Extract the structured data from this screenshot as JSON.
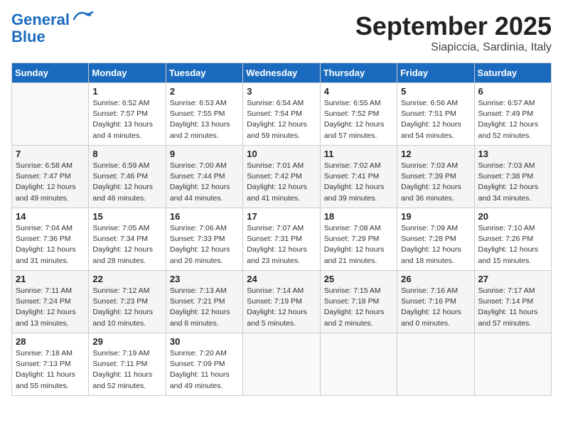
{
  "header": {
    "logo_line1": "General",
    "logo_line2": "Blue",
    "month": "September 2025",
    "location": "Siapiccia, Sardinia, Italy"
  },
  "weekdays": [
    "Sunday",
    "Monday",
    "Tuesday",
    "Wednesday",
    "Thursday",
    "Friday",
    "Saturday"
  ],
  "weeks": [
    [
      {
        "day": "",
        "info": ""
      },
      {
        "day": "1",
        "info": "Sunrise: 6:52 AM\nSunset: 7:57 PM\nDaylight: 13 hours\nand 4 minutes."
      },
      {
        "day": "2",
        "info": "Sunrise: 6:53 AM\nSunset: 7:55 PM\nDaylight: 13 hours\nand 2 minutes."
      },
      {
        "day": "3",
        "info": "Sunrise: 6:54 AM\nSunset: 7:54 PM\nDaylight: 12 hours\nand 59 minutes."
      },
      {
        "day": "4",
        "info": "Sunrise: 6:55 AM\nSunset: 7:52 PM\nDaylight: 12 hours\nand 57 minutes."
      },
      {
        "day": "5",
        "info": "Sunrise: 6:56 AM\nSunset: 7:51 PM\nDaylight: 12 hours\nand 54 minutes."
      },
      {
        "day": "6",
        "info": "Sunrise: 6:57 AM\nSunset: 7:49 PM\nDaylight: 12 hours\nand 52 minutes."
      }
    ],
    [
      {
        "day": "7",
        "info": "Sunrise: 6:58 AM\nSunset: 7:47 PM\nDaylight: 12 hours\nand 49 minutes."
      },
      {
        "day": "8",
        "info": "Sunrise: 6:59 AM\nSunset: 7:46 PM\nDaylight: 12 hours\nand 46 minutes."
      },
      {
        "day": "9",
        "info": "Sunrise: 7:00 AM\nSunset: 7:44 PM\nDaylight: 12 hours\nand 44 minutes."
      },
      {
        "day": "10",
        "info": "Sunrise: 7:01 AM\nSunset: 7:42 PM\nDaylight: 12 hours\nand 41 minutes."
      },
      {
        "day": "11",
        "info": "Sunrise: 7:02 AM\nSunset: 7:41 PM\nDaylight: 12 hours\nand 39 minutes."
      },
      {
        "day": "12",
        "info": "Sunrise: 7:03 AM\nSunset: 7:39 PM\nDaylight: 12 hours\nand 36 minutes."
      },
      {
        "day": "13",
        "info": "Sunrise: 7:03 AM\nSunset: 7:38 PM\nDaylight: 12 hours\nand 34 minutes."
      }
    ],
    [
      {
        "day": "14",
        "info": "Sunrise: 7:04 AM\nSunset: 7:36 PM\nDaylight: 12 hours\nand 31 minutes."
      },
      {
        "day": "15",
        "info": "Sunrise: 7:05 AM\nSunset: 7:34 PM\nDaylight: 12 hours\nand 28 minutes."
      },
      {
        "day": "16",
        "info": "Sunrise: 7:06 AM\nSunset: 7:33 PM\nDaylight: 12 hours\nand 26 minutes."
      },
      {
        "day": "17",
        "info": "Sunrise: 7:07 AM\nSunset: 7:31 PM\nDaylight: 12 hours\nand 23 minutes."
      },
      {
        "day": "18",
        "info": "Sunrise: 7:08 AM\nSunset: 7:29 PM\nDaylight: 12 hours\nand 21 minutes."
      },
      {
        "day": "19",
        "info": "Sunrise: 7:09 AM\nSunset: 7:28 PM\nDaylight: 12 hours\nand 18 minutes."
      },
      {
        "day": "20",
        "info": "Sunrise: 7:10 AM\nSunset: 7:26 PM\nDaylight: 12 hours\nand 15 minutes."
      }
    ],
    [
      {
        "day": "21",
        "info": "Sunrise: 7:11 AM\nSunset: 7:24 PM\nDaylight: 12 hours\nand 13 minutes."
      },
      {
        "day": "22",
        "info": "Sunrise: 7:12 AM\nSunset: 7:23 PM\nDaylight: 12 hours\nand 10 minutes."
      },
      {
        "day": "23",
        "info": "Sunrise: 7:13 AM\nSunset: 7:21 PM\nDaylight: 12 hours\nand 8 minutes."
      },
      {
        "day": "24",
        "info": "Sunrise: 7:14 AM\nSunset: 7:19 PM\nDaylight: 12 hours\nand 5 minutes."
      },
      {
        "day": "25",
        "info": "Sunrise: 7:15 AM\nSunset: 7:18 PM\nDaylight: 12 hours\nand 2 minutes."
      },
      {
        "day": "26",
        "info": "Sunrise: 7:16 AM\nSunset: 7:16 PM\nDaylight: 12 hours\nand 0 minutes."
      },
      {
        "day": "27",
        "info": "Sunrise: 7:17 AM\nSunset: 7:14 PM\nDaylight: 11 hours\nand 57 minutes."
      }
    ],
    [
      {
        "day": "28",
        "info": "Sunrise: 7:18 AM\nSunset: 7:13 PM\nDaylight: 11 hours\nand 55 minutes."
      },
      {
        "day": "29",
        "info": "Sunrise: 7:19 AM\nSunset: 7:11 PM\nDaylight: 11 hours\nand 52 minutes."
      },
      {
        "day": "30",
        "info": "Sunrise: 7:20 AM\nSunset: 7:09 PM\nDaylight: 11 hours\nand 49 minutes."
      },
      {
        "day": "",
        "info": ""
      },
      {
        "day": "",
        "info": ""
      },
      {
        "day": "",
        "info": ""
      },
      {
        "day": "",
        "info": ""
      }
    ]
  ]
}
